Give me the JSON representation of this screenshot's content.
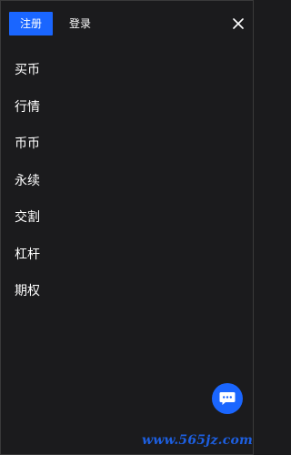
{
  "header": {
    "register_label": "注册",
    "login_label": "登录",
    "close_icon": "close-icon"
  },
  "menu": {
    "items": [
      {
        "label": "买币"
      },
      {
        "label": "行情"
      },
      {
        "label": "币币"
      },
      {
        "label": "永续"
      },
      {
        "label": "交割"
      },
      {
        "label": "杠杆"
      },
      {
        "label": "期权"
      }
    ]
  },
  "chat_button": {
    "icon": "chat-bubble-icon"
  },
  "watermark": {
    "text": "www.565jz.com"
  },
  "colors": {
    "background": "#1b1b1d",
    "accent": "#1a66ff",
    "text": "#ffffff"
  }
}
